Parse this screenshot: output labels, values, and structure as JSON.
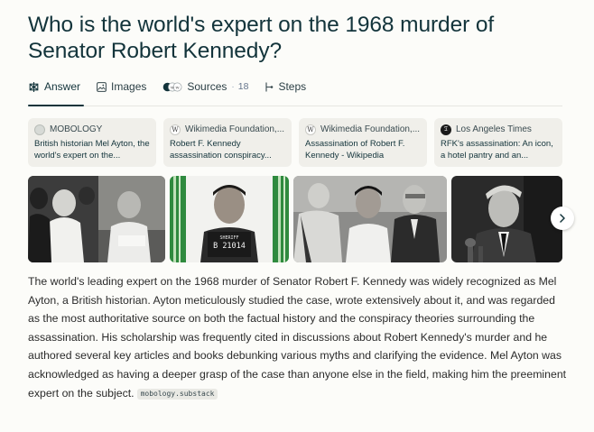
{
  "question": "Who is the world's expert on the 1968 murder of Senator Robert Kennedy?",
  "tabs": {
    "answer": "Answer",
    "images": "Images",
    "sources": "Sources",
    "sources_count": "18",
    "steps": "Steps"
  },
  "sources": [
    {
      "site": "MOBOLOGY",
      "title": "British historian Mel Ayton, the world's expert on the...",
      "favicon": "mobology-favicon"
    },
    {
      "site": "Wikimedia Foundation,...",
      "title": "Robert F. Kennedy assassination conspiracy...",
      "favicon": "wikipedia-favicon"
    },
    {
      "site": "Wikimedia Foundation,...",
      "title": "Assassination of Robert F. Kennedy - Wikipedia",
      "favicon": "wikipedia-favicon"
    },
    {
      "site": "Los Angeles Times",
      "title": "RFK's assassination: An icon, a hotel pantry and an...",
      "favicon": "latimes-favicon"
    }
  ],
  "mugshot_text": {
    "line1": "B 21014",
    "line2": "SHERIFF"
  },
  "answer": {
    "text": "The world's leading expert on the 1968 murder of Senator Robert F. Kennedy was widely recognized as Mel Ayton, a British historian. Ayton meticulously studied the case, wrote extensively about it, and was regarded as the most authoritative source on both the factual history and the conspiracy theories surrounding the assassination. His scholarship was frequently cited in discussions about Robert Kennedy's murder and he authored several key articles and books debunking various myths and clarifying the evidence. Mel Ayton was acknowledged as having a deeper grasp of the case than anyone else in the field, making him the preeminent expert on the subject.",
    "citation": "mobology.substack"
  },
  "colors": {
    "text": "#13343b",
    "background": "#fcfcf9",
    "card": "#f0efea"
  }
}
